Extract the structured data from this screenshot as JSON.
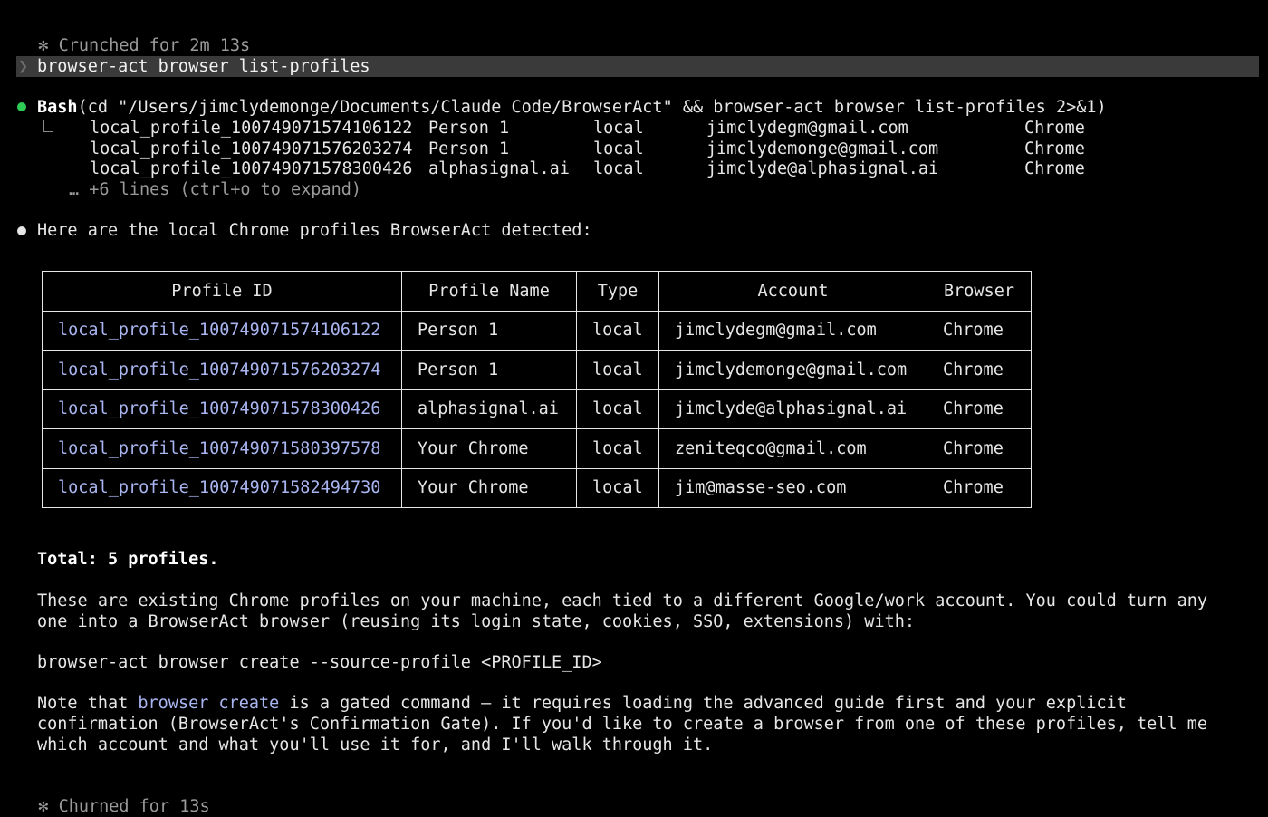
{
  "status_top": {
    "icon": "asterisk-icon",
    "text": "Crunched for 2m 13s"
  },
  "prompt": {
    "chevron": "❯",
    "command": "browser-act browser list-profiles"
  },
  "bash": {
    "label": "Bash",
    "command": "(cd \"/Users/jimclydemonge/Documents/Claude Code/BrowserAct\" && browser-act browser list-profiles 2>&1)",
    "rows": [
      [
        "local_profile_100749071574106122",
        "Person 1",
        "local",
        "jimclydegm@gmail.com",
        "Chrome"
      ],
      [
        "local_profile_100749071576203274",
        "Person 1",
        "local",
        "jimclydemonge@gmail.com",
        "Chrome"
      ],
      [
        "local_profile_100749071578300426",
        "alphasignal.ai",
        "local",
        "jimclyde@alphasignal.ai",
        "Chrome"
      ]
    ],
    "more": "… +6 lines (ctrl+o to expand)"
  },
  "response": {
    "intro": "Here are the local Chrome profiles BrowserAct detected:",
    "table": {
      "headers": [
        "Profile ID",
        "Profile Name",
        "Type",
        "Account",
        "Browser"
      ],
      "rows": [
        [
          "local_profile_100749071574106122",
          "Person 1",
          "local",
          "jimclydegm@gmail.com",
          "Chrome"
        ],
        [
          "local_profile_100749071576203274",
          "Person 1",
          "local",
          "jimclydemonge@gmail.com",
          "Chrome"
        ],
        [
          "local_profile_100749071578300426",
          "alphasignal.ai",
          "local",
          "jimclyde@alphasignal.ai",
          "Chrome"
        ],
        [
          "local_profile_100749071580397578",
          "Your Chrome",
          "local",
          "zeniteqco@gmail.com",
          "Chrome"
        ],
        [
          "local_profile_100749071582494730",
          "Your Chrome",
          "local",
          "jim@masse-seo.com",
          "Chrome"
        ]
      ]
    },
    "total": "Total: 5 profiles.",
    "para1_line1": "These are existing Chrome profiles on your machine, each tied to a different Google/work account. You could turn any",
    "para1_line2": "one into a BrowserAct browser (reusing its login state, cookies, SSO, extensions) with:",
    "command_example": "browser-act browser create --source-profile <PROFILE_ID>",
    "note_prefix": "Note that ",
    "note_code": "browser create",
    "note_line1_rest": " is a gated command — it requires loading the advanced guide first and your explicit",
    "note_line2": "confirmation (BrowserAct's Confirmation Gate). If you'd like to create a browser from one of these profiles, tell me",
    "note_line3": "which account and what you'll use it for, and I'll walk through it."
  },
  "status_bottom": {
    "icon": "asterisk-icon",
    "text": "Churned for 13s"
  },
  "colors": {
    "background": "#000000",
    "text": "#e6e6e6",
    "dim": "#9a9a9a",
    "link": "#a9b5f0",
    "success_dot": "#2ecc55",
    "prompt_bar": "#3a3a3a"
  }
}
